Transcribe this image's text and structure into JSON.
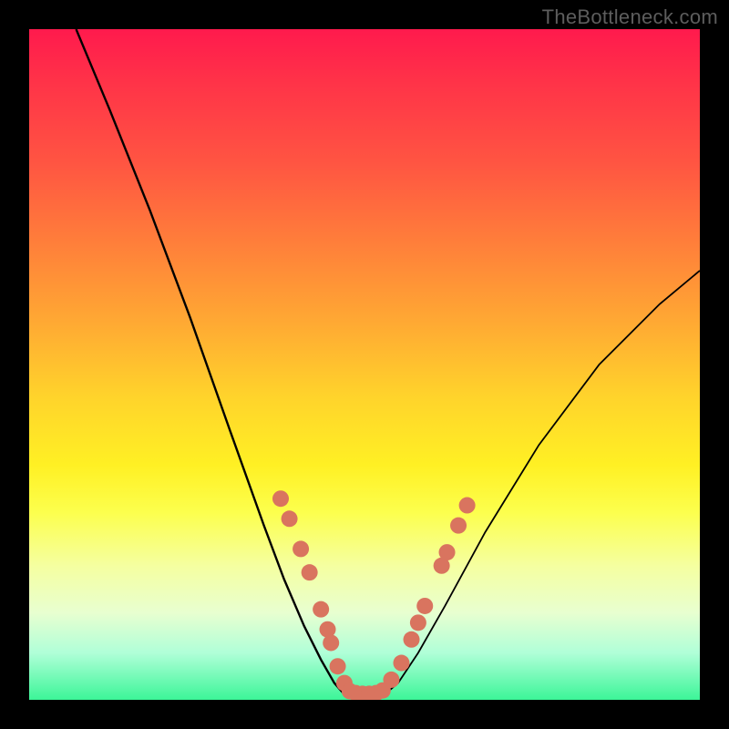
{
  "watermark": "TheBottleneck.com",
  "chart_data": {
    "type": "line",
    "title": "",
    "xlabel": "",
    "ylabel": "",
    "xlim": [
      0,
      100
    ],
    "ylim": [
      0,
      100
    ],
    "series": [
      {
        "name": "curve-left",
        "x": [
          7,
          12,
          18,
          24,
          30,
          35,
          38,
          41,
          43.5,
          45.5,
          47
        ],
        "y": [
          100,
          88,
          73,
          57,
          40,
          26,
          18,
          11,
          6,
          2.5,
          0.8
        ]
      },
      {
        "name": "curve-right",
        "x": [
          53,
          55,
          58,
          62,
          68,
          76,
          85,
          94,
          100
        ],
        "y": [
          0.8,
          2.5,
          7,
          14,
          25,
          38,
          50,
          59,
          64
        ]
      },
      {
        "name": "curve-bottom",
        "x": [
          47,
          48.5,
          50,
          51.5,
          53
        ],
        "y": [
          0.8,
          0.4,
          0.3,
          0.4,
          0.8
        ]
      }
    ],
    "markers": {
      "name": "highlight-points",
      "color": "#d9745f",
      "points": [
        {
          "x": 37.5,
          "y": 30
        },
        {
          "x": 38.8,
          "y": 27
        },
        {
          "x": 40.5,
          "y": 22.5
        },
        {
          "x": 41.8,
          "y": 19
        },
        {
          "x": 43.5,
          "y": 13.5
        },
        {
          "x": 44.5,
          "y": 10.5
        },
        {
          "x": 45,
          "y": 8.5
        },
        {
          "x": 46,
          "y": 5
        },
        {
          "x": 47,
          "y": 2.5
        },
        {
          "x": 47.8,
          "y": 1.3
        },
        {
          "x": 48.7,
          "y": 1
        },
        {
          "x": 49.7,
          "y": 0.9
        },
        {
          "x": 50.7,
          "y": 0.9
        },
        {
          "x": 51.7,
          "y": 1
        },
        {
          "x": 52.7,
          "y": 1.4
        },
        {
          "x": 54,
          "y": 3
        },
        {
          "x": 55.5,
          "y": 5.5
        },
        {
          "x": 57,
          "y": 9
        },
        {
          "x": 58,
          "y": 11.5
        },
        {
          "x": 59,
          "y": 14
        },
        {
          "x": 61.5,
          "y": 20
        },
        {
          "x": 62.3,
          "y": 22
        },
        {
          "x": 64,
          "y": 26
        },
        {
          "x": 65.3,
          "y": 29
        }
      ]
    },
    "gradient_stops": [
      {
        "pos": 0,
        "color": "#ff1a4d"
      },
      {
        "pos": 50,
        "color": "#ffd42b"
      },
      {
        "pos": 100,
        "color": "#3cf598"
      }
    ]
  }
}
